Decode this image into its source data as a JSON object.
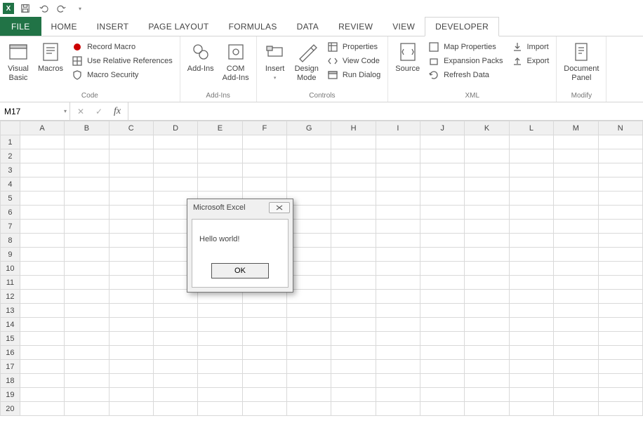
{
  "qat": {
    "save": "save-icon",
    "undo": "undo-icon",
    "redo": "redo-icon"
  },
  "tabs": {
    "file": "FILE",
    "home": "HOME",
    "insert": "INSERT",
    "page_layout": "PAGE LAYOUT",
    "formulas": "FORMULAS",
    "data": "DATA",
    "review": "REVIEW",
    "view": "VIEW",
    "developer": "DEVELOPER"
  },
  "ribbon": {
    "code": {
      "label": "Code",
      "visual_basic": "Visual\nBasic",
      "macros": "Macros",
      "record_macro": "Record Macro",
      "use_relative": "Use Relative References",
      "macro_security": "Macro Security"
    },
    "addins": {
      "label": "Add-Ins",
      "addins": "Add-Ins",
      "com_addins": "COM\nAdd-Ins"
    },
    "controls": {
      "label": "Controls",
      "insert": "Insert",
      "design_mode": "Design\nMode",
      "properties": "Properties",
      "view_code": "View Code",
      "run_dialog": "Run Dialog"
    },
    "xml": {
      "label": "XML",
      "source": "Source",
      "map_properties": "Map Properties",
      "expansion_packs": "Expansion Packs",
      "refresh_data": "Refresh Data",
      "import": "Import",
      "export": "Export"
    },
    "modify": {
      "label": "Modify",
      "document_panel": "Document\nPanel"
    }
  },
  "formula_bar": {
    "name_box": "M17",
    "fx": "fx"
  },
  "grid": {
    "columns": [
      "A",
      "B",
      "C",
      "D",
      "E",
      "F",
      "G",
      "H",
      "I",
      "J",
      "K",
      "L",
      "M",
      "N"
    ],
    "rows": [
      1,
      2,
      3,
      4,
      5,
      6,
      7,
      8,
      9,
      10,
      11,
      12,
      13,
      14,
      15,
      16,
      17,
      18,
      19,
      20
    ]
  },
  "dialog": {
    "title": "Microsoft Excel",
    "message": "Hello world!",
    "ok": "OK"
  }
}
